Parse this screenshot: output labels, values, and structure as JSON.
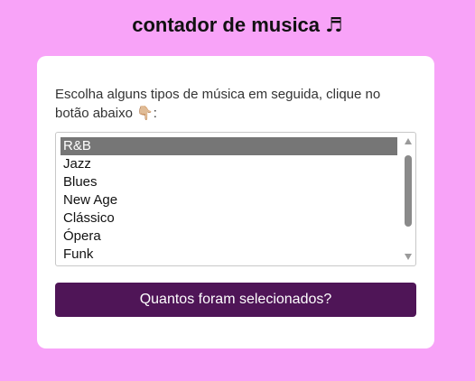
{
  "header": {
    "title": "contador de musica",
    "title_emoji": "♬"
  },
  "card": {
    "instructions": "Escolha alguns tipos de música em seguida, clique no botão abaixo",
    "instructions_emoji": "👇🏼",
    "instructions_suffix": ":",
    "music_types": [
      "R&B",
      "Jazz",
      "Blues",
      "New Age",
      "Clássico",
      "Ópera",
      "Funk"
    ],
    "selected_option": "R&B",
    "button_label": "Quantos foram selecionados?"
  },
  "colors": {
    "background": "#f8a3f8",
    "button": "#4f1557",
    "selected_option": "#767676"
  }
}
